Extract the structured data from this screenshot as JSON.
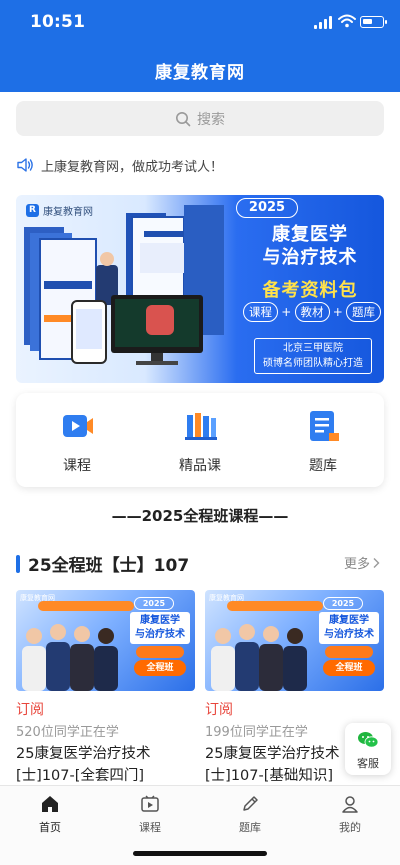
{
  "status": {
    "time": "10:51"
  },
  "header": {
    "title": "康复教育网"
  },
  "search": {
    "placeholder": "搜索",
    "icon": "search-icon"
  },
  "notice": {
    "text": "上康复教育网，做成功考试人！",
    "icon": "speaker-icon"
  },
  "banner": {
    "logo_text": "康复教育网",
    "year": "2025",
    "title_line1": "康复医学",
    "title_line2": "与治疗技术",
    "subtitle": "备考资料包",
    "tags": [
      "课程",
      "教材",
      "题库"
    ],
    "plus": "+",
    "box_line1": "北京三甲医院",
    "box_line2": "硕博名师团队精心打造",
    "colors": {
      "blue": "#1E6FE6",
      "yellow": "#ffe24a"
    }
  },
  "categories": [
    {
      "label": "课程",
      "icon": "video-course-icon"
    },
    {
      "label": "精品课",
      "icon": "books-icon"
    },
    {
      "label": "题库",
      "icon": "question-bank-icon"
    }
  ],
  "section_heading": "——2025全程班课程——",
  "row": {
    "title": "25全程班【士】107",
    "more": "更多"
  },
  "courses": [
    {
      "subscribe": "订阅",
      "learners": "520位同学正在学",
      "title_line1": "25康复医学治疗技术",
      "title_line2": "[士]107-[全套四门]",
      "thumb": {
        "year": "2025",
        "line1": "康复医学",
        "line2": "与治疗技术",
        "btn": "全程班"
      }
    },
    {
      "subscribe": "订阅",
      "learners": "199位同学正在学",
      "title_line1": "25康复医学治疗技术",
      "title_line2": "[士]107-[基础知识]",
      "thumb": {
        "year": "2025",
        "line1": "康复医学",
        "line2": "与治疗技术",
        "btn": "全程班"
      }
    }
  ],
  "service": {
    "label": "客服",
    "icon": "wechat-icon"
  },
  "tabbar": [
    {
      "label": "首页",
      "icon": "home-icon",
      "active": true
    },
    {
      "label": "课程",
      "icon": "course-play-icon",
      "active": false
    },
    {
      "label": "题库",
      "icon": "pencil-icon",
      "active": false
    },
    {
      "label": "我的",
      "icon": "user-icon",
      "active": false
    }
  ]
}
